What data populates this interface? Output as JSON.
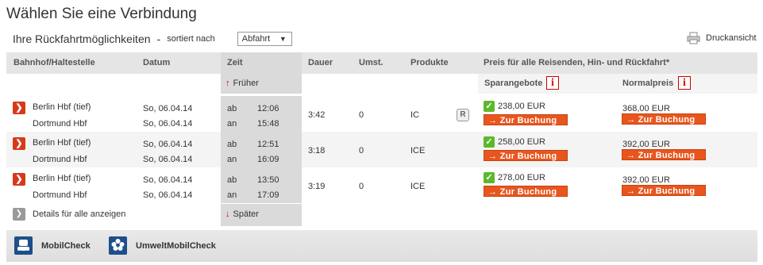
{
  "page": {
    "title": "Wählen Sie eine Verbindung",
    "subtitle": "Ihre Rückfahrtmöglichkeiten",
    "dash": "-",
    "sorted_label": "sortiert nach",
    "sort_value": "Abfahrt",
    "print_label": "Druckansicht"
  },
  "table": {
    "headers": {
      "station": "Bahnhof/Haltestelle",
      "date": "Datum",
      "time": "Zeit",
      "duration": "Dauer",
      "changes": "Umst.",
      "products": "Produkte",
      "price": "Preis für alle Reisenden, Hin- und Rückfahrt*"
    },
    "earlier": "Früher",
    "later": "Später",
    "saver_label": "Sparangebote",
    "normal_label": "Normalpreis",
    "book_label": "→ Zur Buchung",
    "details_label": "Details für alle anzeigen",
    "rows": [
      {
        "from": "Berlin Hbf (tief)",
        "to": "Dortmund Hbf",
        "date_dep": "So, 06.04.14",
        "date_arr": "So, 06.04.14",
        "dep_label": "ab",
        "arr_label": "an",
        "dep_time": "12:06",
        "arr_time": "15:48",
        "duration": "3:42",
        "changes": "0",
        "product": "IC",
        "badge": "R",
        "saver_price": "238,00 EUR",
        "normal_price": "368,00 EUR"
      },
      {
        "from": "Berlin Hbf (tief)",
        "to": "Dortmund Hbf",
        "date_dep": "So, 06.04.14",
        "date_arr": "So, 06.04.14",
        "dep_label": "ab",
        "arr_label": "an",
        "dep_time": "12:51",
        "arr_time": "16:09",
        "duration": "3:18",
        "changes": "0",
        "product": "ICE",
        "saver_price": "258,00 EUR",
        "normal_price": "392,00 EUR"
      },
      {
        "from": "Berlin Hbf (tief)",
        "to": "Dortmund Hbf",
        "date_dep": "So, 06.04.14",
        "date_arr": "So, 06.04.14",
        "dep_label": "ab",
        "arr_label": "an",
        "dep_time": "13:50",
        "arr_time": "17:09",
        "duration": "3:19",
        "changes": "0",
        "product": "ICE",
        "saver_price": "278,00 EUR",
        "normal_price": "392,00 EUR"
      }
    ]
  },
  "bottom": {
    "mobilcheck": "MobilCheck",
    "umwelt": "UmweltMobilCheck"
  },
  "colors": {
    "accent": "#e8561e",
    "select_button": "#d63a1b",
    "check": "#5cb82c",
    "header_bg": "#e5e5e5",
    "time_col_bg": "#dadada",
    "icon_blue": "#1d4f8a"
  },
  "icons": {
    "select": "chevron-right-icon",
    "print": "printer-icon",
    "info": "info-icon",
    "check": "checkmark-icon",
    "badge": "reservation-icon",
    "mobilcheck": "train-car-icon",
    "umwelt": "flower-icon"
  }
}
